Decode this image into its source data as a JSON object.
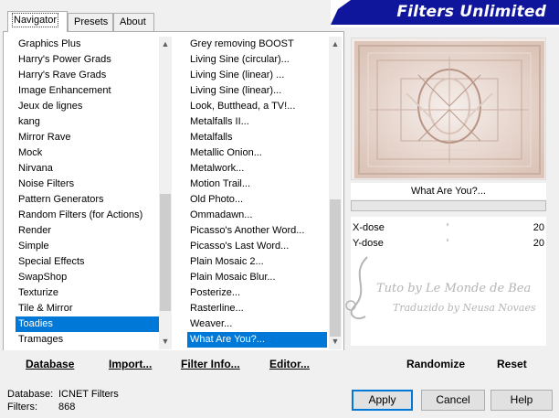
{
  "banner": {
    "title": "Filters Unlimited"
  },
  "tabs": [
    {
      "label": "Navigator",
      "active": true
    },
    {
      "label": "Presets",
      "active": false
    },
    {
      "label": "About",
      "active": false
    }
  ],
  "categories": {
    "items": [
      "Graphics Plus",
      "Harry's Power Grads",
      "Harry's Rave Grads",
      "Image Enhancement",
      "Jeux de lignes",
      "kang",
      "Mirror Rave",
      "Mock",
      "Nirvana",
      "Noise Filters",
      "Pattern Generators",
      "Random Filters (for Actions)",
      "Render",
      "Simple",
      "Special Effects",
      "SwapShop",
      "Texturize",
      "Tile & Mirror",
      "Toadies",
      "Tramages"
    ],
    "selected": "Toadies"
  },
  "filters": {
    "items": [
      "Grey removing BOOST",
      "Living Sine (circular)...",
      "Living Sine (linear) ...",
      "Living Sine (linear)...",
      "Look, Butthead, a TV!...",
      "Metalfalls II...",
      "Metalfalls",
      "Metallic Onion...",
      "Metalwork...",
      "Motion Trail...",
      "Old Photo...",
      "Ommadawn...",
      "Picasso's Another Word...",
      "Picasso's Last Word...",
      "Plain Mosaic 2...",
      "Plain Mosaic Blur...",
      "Posterize...",
      "Rasterline...",
      "Weaver...",
      "What Are You?..."
    ],
    "selected": "What Are You?..."
  },
  "preview": {
    "filter_name": "What Are You?..."
  },
  "params": [
    {
      "label": "X-dose",
      "value": "20"
    },
    {
      "label": "Y-dose",
      "value": "20"
    }
  ],
  "watermark": {
    "line1": "Tuto by Le Monde de Bea",
    "line2": "Traduzido by Neusa Novaes"
  },
  "actions": {
    "database": "Database",
    "import": "Import...",
    "filter_info": "Filter Info...",
    "editor": "Editor...",
    "randomize": "Randomize",
    "reset": "Reset"
  },
  "status": {
    "database_label": "Database:",
    "database_value": "ICNET Filters",
    "filters_label": "Filters:",
    "filters_value": "868"
  },
  "dialog_buttons": {
    "apply": "Apply",
    "cancel": "Cancel",
    "help": "Help"
  },
  "colors": {
    "banner": "#10169c",
    "selection": "#0078d7"
  }
}
